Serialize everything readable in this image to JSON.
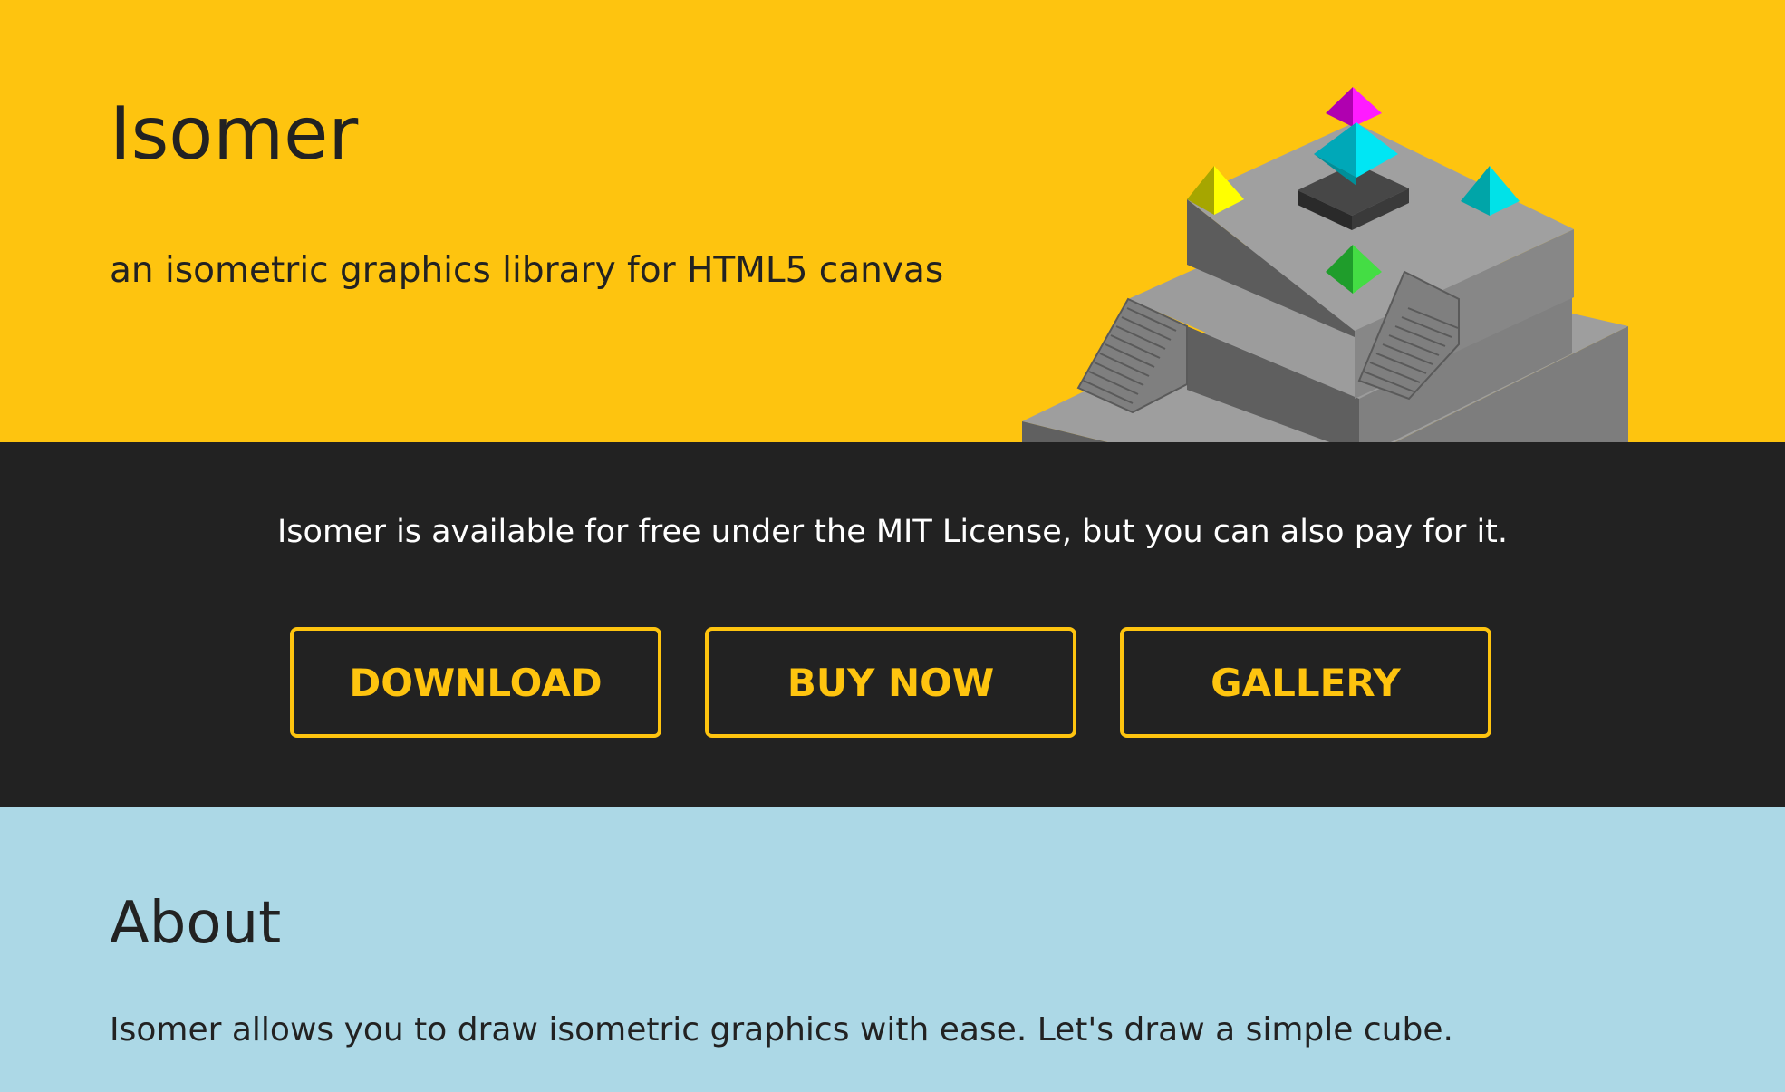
{
  "hero": {
    "title": "Isomer",
    "subtitle": "an isometric graphics library for HTML5 canvas",
    "art_icon": "isometric-temple-illustration",
    "background_color": "#fec40f"
  },
  "license_band": {
    "text": "Isomer is available for free under the MIT License, but you can also pay for it.",
    "background_color": "#222222",
    "buttons": [
      {
        "label": "DOWNLOAD"
      },
      {
        "label": "BUY NOW"
      },
      {
        "label": "GALLERY"
      }
    ],
    "accent_color": "#fec40f"
  },
  "about": {
    "title": "About",
    "text": "Isomer allows you to draw isometric graphics with ease. Let's draw a simple cube.",
    "background_color": "#acd8e6"
  }
}
